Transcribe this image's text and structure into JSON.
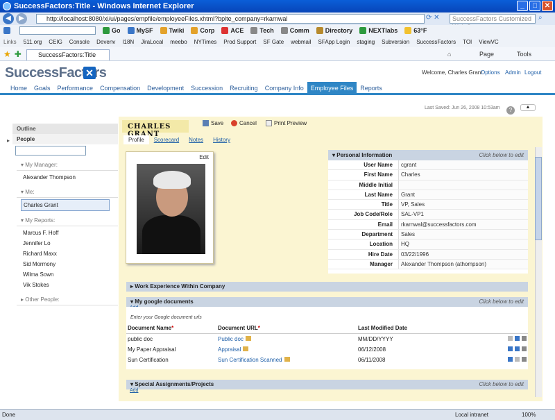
{
  "window": {
    "title": "SuccessFactors:Title - Windows Internet Explorer"
  },
  "browser": {
    "address": "http://localhost:8080/xi/ui/pages/empfile/employeeFiles.xhtml?bplte_company=rkarnwal",
    "search_placeholder": "SuccessFactors Customized Web Searc",
    "toolbar_items": [
      "Go",
      "MySF",
      "Twiki",
      "Corp",
      "ACE",
      "Tech",
      "Comm",
      "Directory",
      "NEXTlabs",
      "63°F"
    ],
    "links_label": "Links",
    "links": [
      "511.org",
      "CEIG",
      "Console",
      "Devenv",
      "I18N",
      "JiraLocal",
      "meebo",
      "NYTimes",
      "Prod Support",
      "SF Gate",
      "webmail",
      "SFApp Login",
      "staging",
      "Subversion",
      "SuccessFactors",
      "TOI",
      "ViewVC"
    ],
    "tab_title": "SuccessFactors:Title",
    "cmd_items": [
      "Page",
      "Tools"
    ],
    "status_left": "Done",
    "status_zone": "Local intranet",
    "zoom": "100%"
  },
  "app": {
    "logo": "SuccessFactors",
    "welcome": "Welcome, Charles Grant",
    "top_links": [
      "Options",
      "Admin",
      "Logout"
    ],
    "nav_tabs": [
      "Home",
      "Goals",
      "Performance",
      "Compensation",
      "Development",
      "Succession",
      "Recruiting",
      "Company Info",
      "Employee Files",
      "Reports"
    ],
    "active_tab": "Employee Files",
    "last_saved": "Last Saved: Jun 26, 2008 10:53am"
  },
  "left_panel": {
    "outline": "Outline",
    "people": "People",
    "my_manager_label": "My Manager:",
    "manager": "Alexander Thompson",
    "me_label": "Me:",
    "me": "Charles Grant",
    "my_reports_label": "My Reports:",
    "reports": [
      "Marcus F. Hoff",
      "Jennifer Lo",
      "Richard Maxx",
      "Sid Mormony",
      "Wilma Sown",
      "Vik Stokes"
    ],
    "other_people_label": "Other People:"
  },
  "employee": {
    "name": "CHARLES GRANT",
    "actions": [
      "Save",
      "Cancel",
      "Print Preview"
    ],
    "subtabs": [
      "Profile",
      "Scorecard",
      "Notes",
      "History"
    ],
    "photo_edit": "Edit"
  },
  "personal_info": {
    "title": "Personal Information",
    "hint": "Click below to edit",
    "rows": [
      {
        "label": "User Name",
        "value": "cgrant"
      },
      {
        "label": "First Name",
        "value": "Charles"
      },
      {
        "label": "Middle Initial",
        "value": ""
      },
      {
        "label": "Last Name",
        "value": "Grant"
      },
      {
        "label": "Title",
        "value": "VP, Sales"
      },
      {
        "label": "Job Code/Role",
        "value": "SAL-VP1"
      },
      {
        "label": "Email",
        "value": "rkarnwal@successfactors.com"
      },
      {
        "label": "Department",
        "value": "Sales"
      },
      {
        "label": "Location",
        "value": "HQ"
      },
      {
        "label": "Hire Date",
        "value": "03/22/1996"
      },
      {
        "label": "Manager",
        "value": "Alexander Thompson (athompson)"
      }
    ]
  },
  "sections": {
    "work_experience": "Work Experience Within Company",
    "google_docs": "My google documents",
    "google_hint": "Click below to edit",
    "add": "Add",
    "google_note": "Enter your Google document urls",
    "columns": [
      "Document Name",
      "Document URL",
      "Last Modified Date"
    ],
    "docs": [
      {
        "name": "public doc",
        "url": "Public doc",
        "date": "MM/DD/YYYY"
      },
      {
        "name": "My Paper Appraisal",
        "url": "Appraisal",
        "date": "06/12/2008"
      },
      {
        "name": "Sun Certification",
        "url": "Sun Certification Scanned",
        "date": "06/11/2008"
      }
    ],
    "special": "Special Assignments/Projects",
    "special_hint": "Click below to edit"
  }
}
